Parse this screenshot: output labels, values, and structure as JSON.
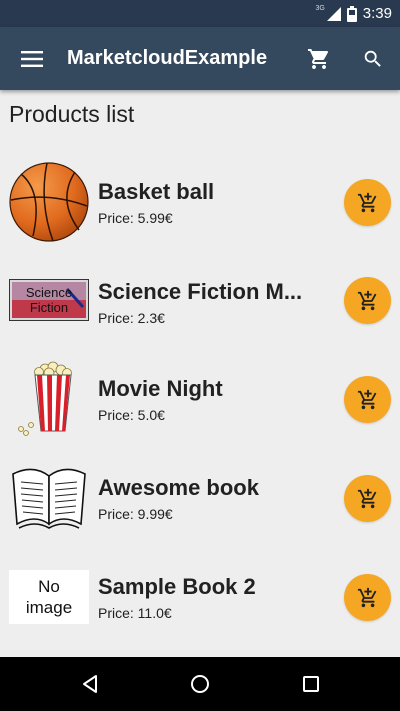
{
  "status_bar": {
    "network": "3G",
    "time": "3:39"
  },
  "app_bar": {
    "title": "MarketcloudExample",
    "menu_icon": "hamburger-menu-icon",
    "cart_icon": "shopping-cart-icon",
    "search_icon": "search-icon",
    "background": "#34495e"
  },
  "main": {
    "section_title": "Products list",
    "products": [
      {
        "name": "Basket ball",
        "price": "Price: 5.99€",
        "image": "basketball-image"
      },
      {
        "name": "Science Fiction M...",
        "price": "Price: 2.3€",
        "image": "science-fiction-image"
      },
      {
        "name": "Movie Night",
        "price": "Price: 5.0€",
        "image": "popcorn-image"
      },
      {
        "name": "Awesome book",
        "price": "Price: 9.99€",
        "image": "open-book-image"
      },
      {
        "name": "Sample Book 2",
        "price": "Price: 11.0€",
        "image": "no-image-placeholder"
      }
    ],
    "no_image_text": "No image",
    "sci_fi_image_text": "Science Fiction",
    "add_button_icon": "add-shopping-cart-icon",
    "accent": "#f5a623"
  },
  "nav_bar": {
    "back_icon": "back-triangle-icon",
    "home_icon": "home-circle-icon",
    "recents_icon": "recents-square-icon"
  }
}
